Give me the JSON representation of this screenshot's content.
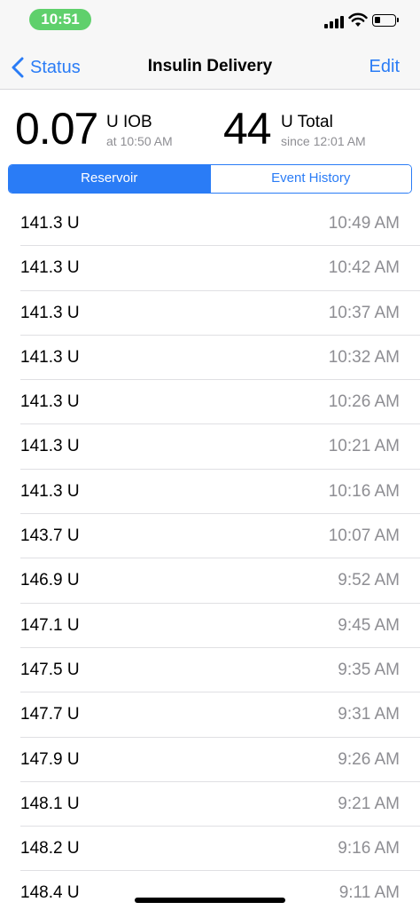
{
  "status_bar": {
    "time": "10:51",
    "signal_icon": "cellular-signal-icon",
    "wifi_icon": "wifi-icon",
    "battery_icon": "battery-icon",
    "battery_level": 0.2,
    "time_pill_color": "#5fd06c"
  },
  "nav": {
    "back_label": "Status",
    "title": "Insulin Delivery",
    "edit_label": "Edit",
    "accent_color": "#2a7cf6"
  },
  "summary": {
    "iob_value": "0.07",
    "iob_unit": "U IOB",
    "iob_sub": "at 10:50 AM",
    "total_value": "44",
    "total_unit": "U Total",
    "total_sub": "since 12:01 AM"
  },
  "segments": {
    "reservoir": "Reservoir",
    "event_history": "Event History",
    "selected": "Reservoir"
  },
  "entries": [
    {
      "amount": "141.3 U",
      "time": "10:49 AM"
    },
    {
      "amount": "141.3 U",
      "time": "10:42 AM"
    },
    {
      "amount": "141.3 U",
      "time": "10:37 AM"
    },
    {
      "amount": "141.3 U",
      "time": "10:32 AM"
    },
    {
      "amount": "141.3 U",
      "time": "10:26 AM"
    },
    {
      "amount": "141.3 U",
      "time": "10:21 AM"
    },
    {
      "amount": "141.3 U",
      "time": "10:16 AM"
    },
    {
      "amount": "143.7 U",
      "time": "10:07 AM"
    },
    {
      "amount": "146.9 U",
      "time": "9:52 AM"
    },
    {
      "amount": "147.1 U",
      "time": "9:45 AM"
    },
    {
      "amount": "147.5 U",
      "time": "9:35 AM"
    },
    {
      "amount": "147.7 U",
      "time": "9:31 AM"
    },
    {
      "amount": "147.9 U",
      "time": "9:26 AM"
    },
    {
      "amount": "148.1 U",
      "time": "9:21 AM"
    },
    {
      "amount": "148.2 U",
      "time": "9:16 AM"
    },
    {
      "amount": "148.4 U",
      "time": "9:11 AM"
    }
  ]
}
